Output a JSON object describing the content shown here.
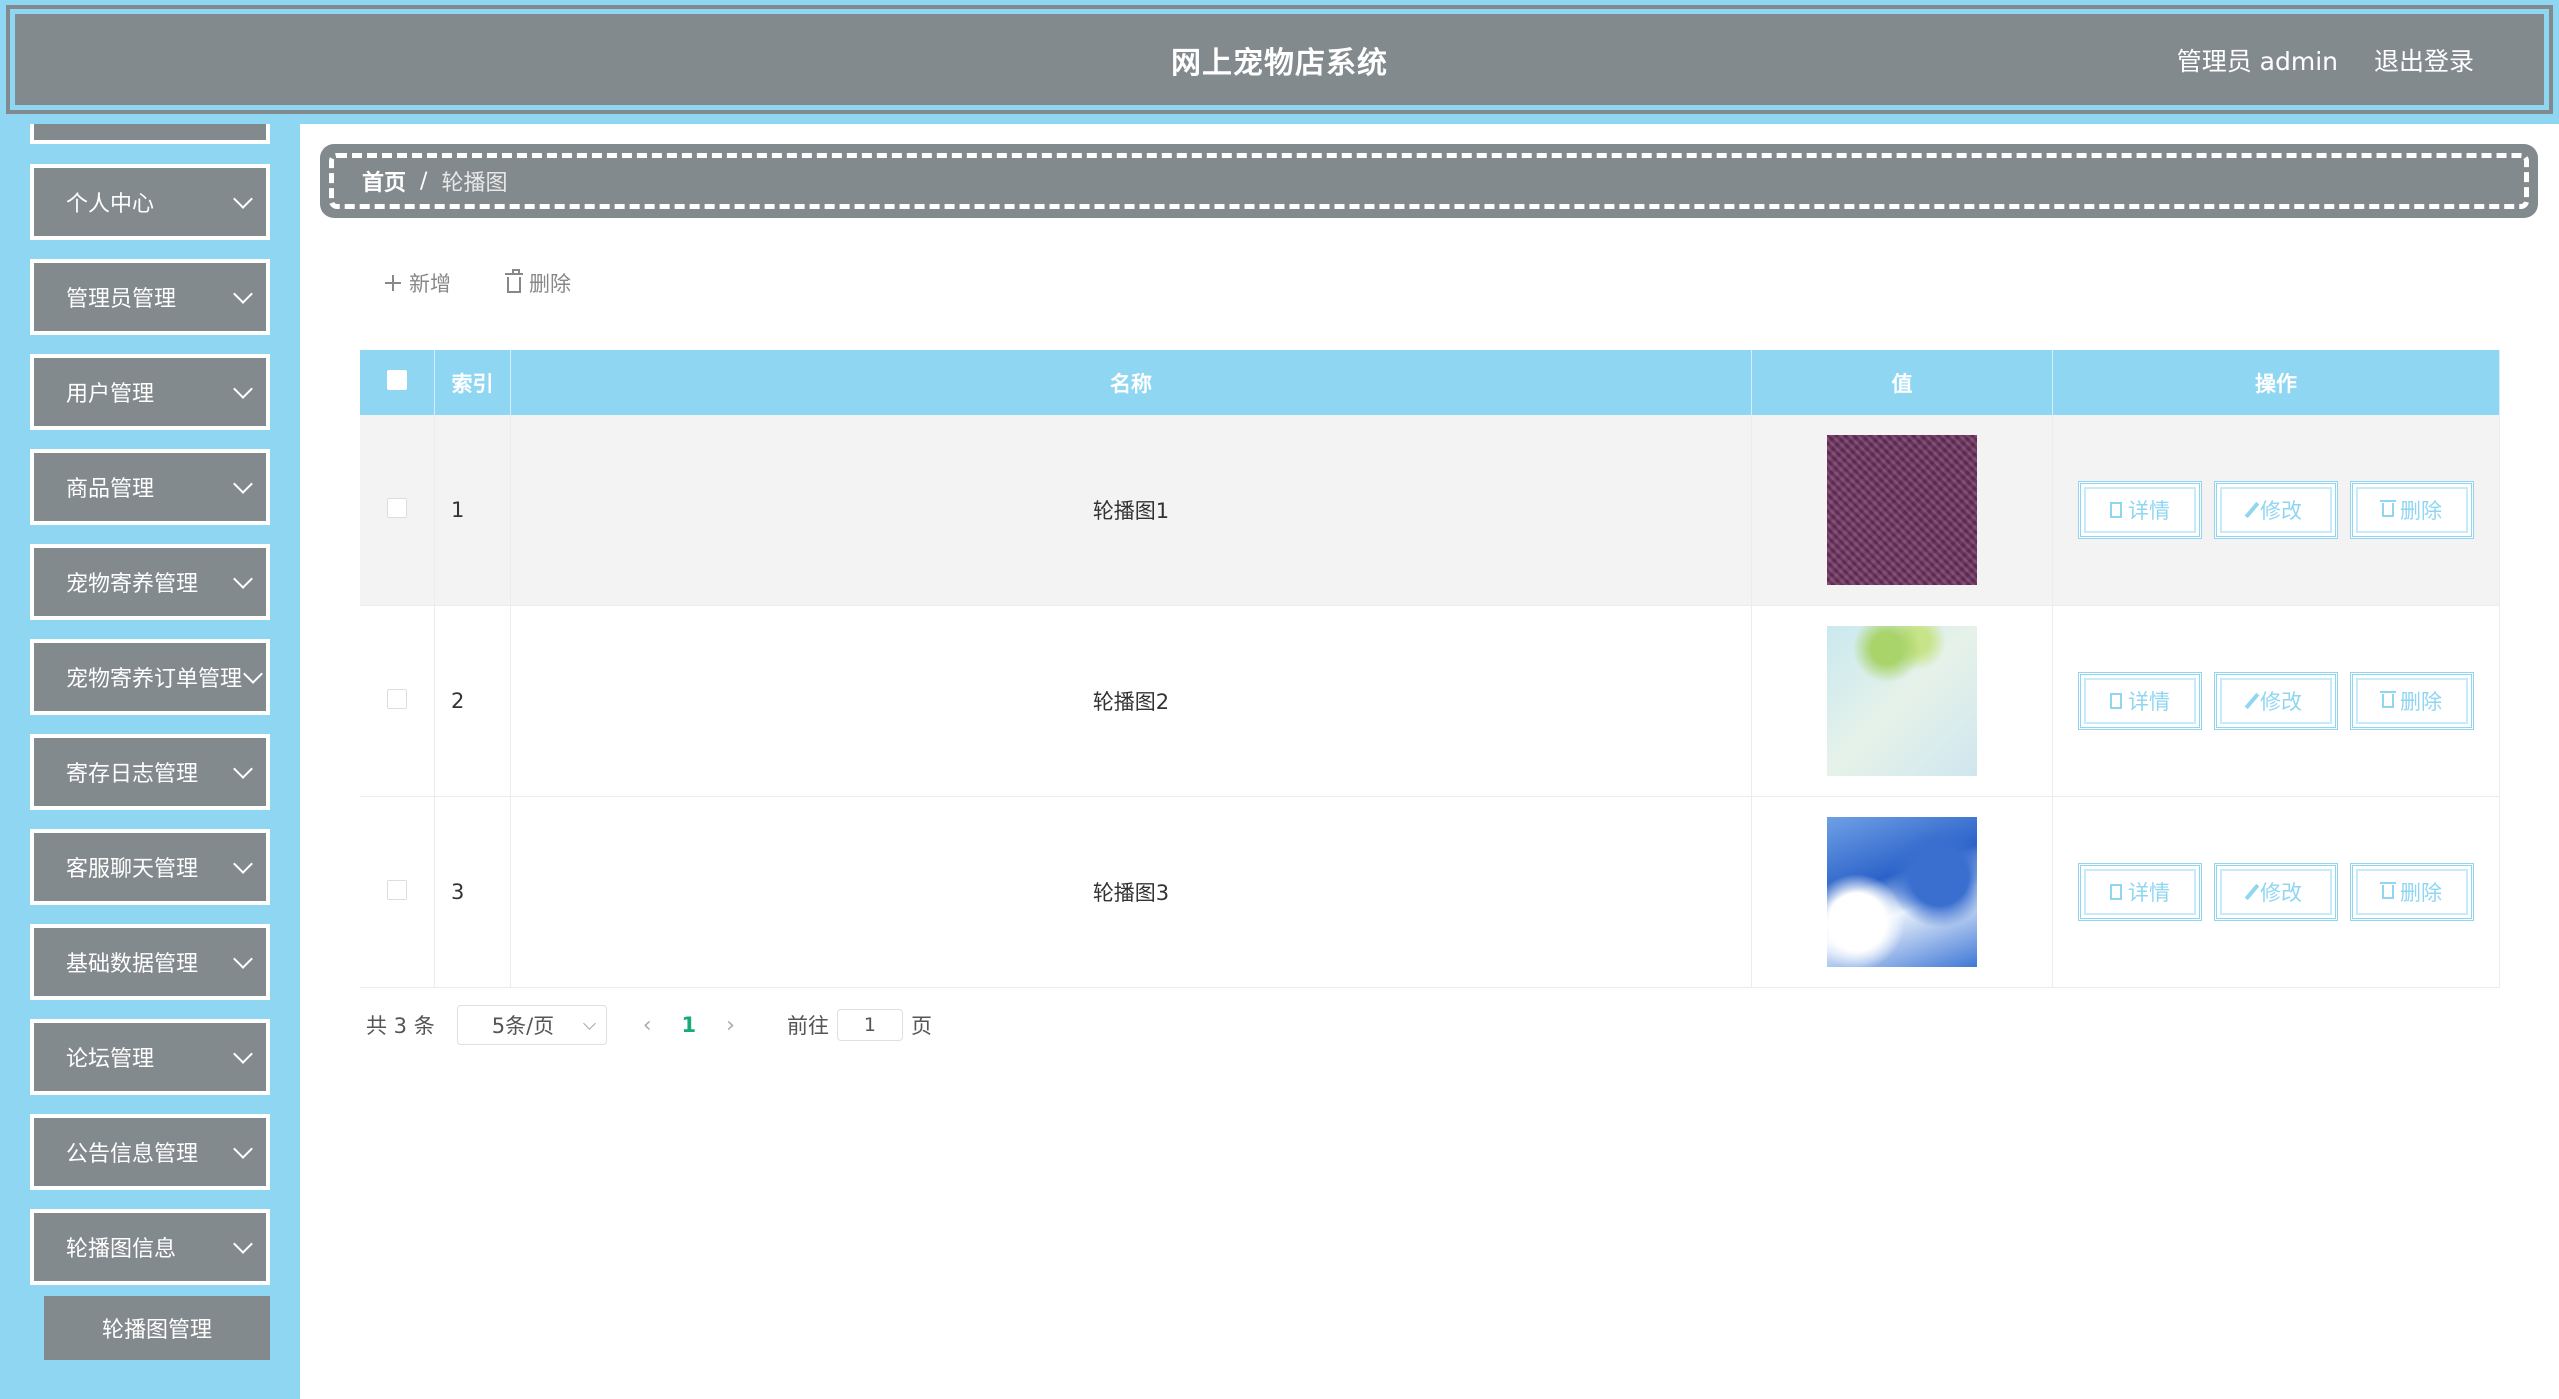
{
  "header": {
    "title": "网上宠物店系统",
    "user_label": "管理员 admin",
    "logout_label": "退出登录"
  },
  "sidebar": {
    "items": [
      {
        "label": "个人中心"
      },
      {
        "label": "管理员管理"
      },
      {
        "label": "用户管理"
      },
      {
        "label": "商品管理"
      },
      {
        "label": "宠物寄养管理"
      },
      {
        "label": "宠物寄养订单管理"
      },
      {
        "label": "寄存日志管理"
      },
      {
        "label": "客服聊天管理"
      },
      {
        "label": "基础数据管理"
      },
      {
        "label": "论坛管理"
      },
      {
        "label": "公告信息管理"
      },
      {
        "label": "轮播图信息"
      }
    ],
    "submenu_label": "轮播图管理"
  },
  "breadcrumb": {
    "home": "首页",
    "separator": "/",
    "current": "轮播图"
  },
  "toolbar": {
    "add_label": "新增",
    "delete_label": "删除"
  },
  "table": {
    "headers": {
      "index": "索引",
      "name": "名称",
      "value": "值",
      "ops": "操作"
    },
    "rows": [
      {
        "index": "1",
        "name": "轮播图1"
      },
      {
        "index": "2",
        "name": "轮播图2"
      },
      {
        "index": "3",
        "name": "轮播图3"
      }
    ],
    "op_labels": {
      "detail": "详情",
      "edit": "修改",
      "delete": "删除"
    }
  },
  "pagination": {
    "total": "共 3 条",
    "page_size": "5条/页",
    "current_page": "1",
    "goto_label": "前往",
    "goto_value": "1",
    "page_suffix": "页"
  },
  "colors": {
    "accent": "#8fd6f2",
    "panel": "#838a8e",
    "page_active": "#19a97b"
  }
}
